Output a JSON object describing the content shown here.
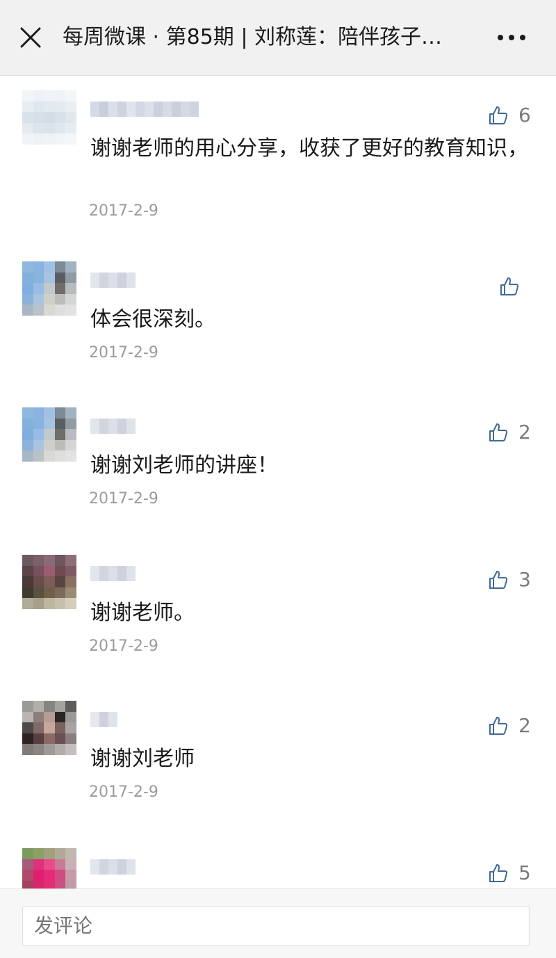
{
  "header": {
    "title": "每周微课 · 第85期 | 刘称莲：陪伴孩子…",
    "close_icon": "close-icon",
    "more_icon": "more-icon"
  },
  "comments": [
    {
      "text": "谢谢老师的用心分享，收获了更好的教育知识，",
      "date": "2017-2-9",
      "likes": "6"
    },
    {
      "text": "体会很深刻。",
      "date": "2017-2-9",
      "likes": ""
    },
    {
      "text": "谢谢刘老师的讲座！",
      "date": "2017-2-9",
      "likes": "2"
    },
    {
      "text": "谢谢老师。",
      "date": "2017-2-9",
      "likes": "3"
    },
    {
      "text": "谢谢刘老师",
      "date": "2017-2-9",
      "likes": "2"
    },
    {
      "text": "",
      "date": "",
      "likes": "5"
    }
  ],
  "composer": {
    "placeholder": "发评论"
  },
  "colors": {
    "accent_icon": "#3f6a9a",
    "date": "#9a9a9a"
  }
}
